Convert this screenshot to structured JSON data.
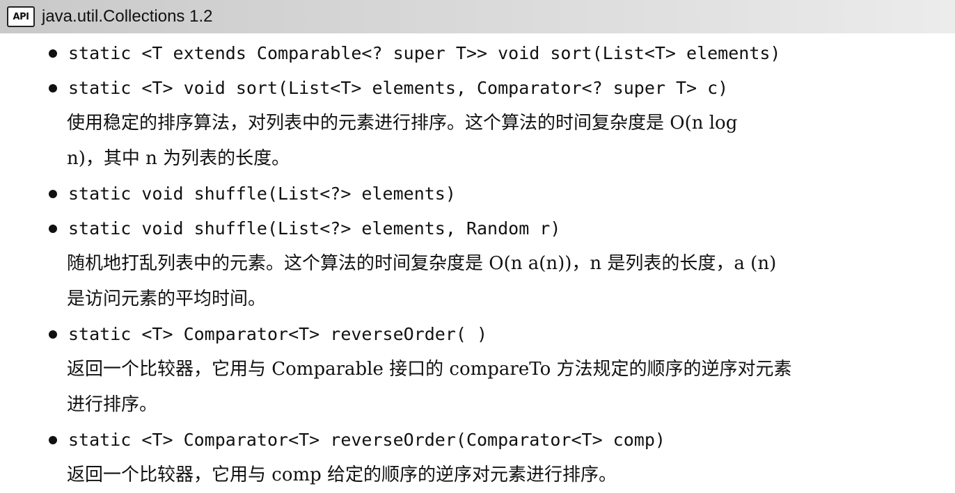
{
  "header": {
    "badge": "API",
    "title": "java.util.Collections 1.2"
  },
  "methods": [
    {
      "signatures": [
        "static <T extends Comparable<? super T>> void sort(List<T> elements)",
        "static <T> void sort(List<T> elements, Comparator<? super T> c)"
      ],
      "description": [
        "使用稳定的排序算法，对列表中的元素进行排序。这个算法的时间复杂度是 O(n log",
        "n)，其中 n 为列表的长度。"
      ]
    },
    {
      "signatures": [
        "static void shuffle(List<?> elements)",
        "static void shuffle(List<?> elements, Random r)"
      ],
      "description": [
        "随机地打乱列表中的元素。这个算法的时间复杂度是 O(n a(n))，n 是列表的长度，a (n)",
        "是访问元素的平均时间。"
      ]
    },
    {
      "signatures": [
        "static <T> Comparator<T> reverseOrder( )"
      ],
      "description": [
        "返回一个比较器，它用与 Comparable 接口的 compareTo 方法规定的顺序的逆序对元素",
        "进行排序。"
      ]
    },
    {
      "signatures": [
        "static <T> Comparator<T> reverseOrder(Comparator<T> comp)"
      ],
      "description": [
        "返回一个比较器，它用与 comp 给定的顺序的逆序对元素进行排序。"
      ]
    }
  ]
}
